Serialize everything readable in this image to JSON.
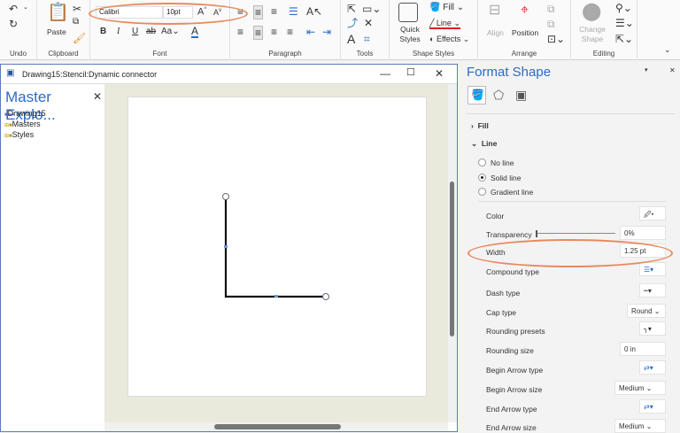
{
  "ribbon": {
    "groups": {
      "undo": "Undo",
      "clipboard": "Clipboard",
      "font": "Font",
      "paragraph": "Paragraph",
      "tools": "Tools",
      "shape_styles": "Shape Styles",
      "arrange": "Arrange",
      "editing": "Editing"
    },
    "paste_label": "Paste",
    "font_name": "Calibri",
    "font_size": "10pt",
    "quick_styles_label": "Quick Styles",
    "fill_label": "Fill",
    "line_label": "Line",
    "effects_label": "Effects",
    "align_label": "Align",
    "position_label": "Position",
    "change_shape_label": "Change Shape"
  },
  "drawing_window": {
    "title": "Drawing15:Stencil:Dynamic connector",
    "explorer_title": "Master Explo...",
    "tree": [
      "Drawing15",
      "Masters",
      "Styles"
    ]
  },
  "format_shape": {
    "title": "Format Shape",
    "fill_label": "Fill",
    "line_label": "Line",
    "line_options": [
      "No line",
      "Solid line",
      "Gradient line"
    ],
    "selected_line_option": "Solid line",
    "color_label": "Color",
    "transparency_label": "Transparency",
    "transparency_value": "0%",
    "width_label": "Width",
    "width_value": "1.25 pt",
    "compound_label": "Compound type",
    "dash_label": "Dash type",
    "cap_label": "Cap type",
    "cap_value": "Round",
    "rounding_presets_label": "Rounding presets",
    "rounding_size_label": "Rounding size",
    "rounding_size_value": "0 in",
    "begin_arrow_type_label": "Begin Arrow type",
    "begin_arrow_size_label": "Begin Arrow size",
    "begin_arrow_size_value": "Medium",
    "end_arrow_type_label": "End Arrow type",
    "end_arrow_size_label": "End Arrow size",
    "end_arrow_size_value": "Medium"
  },
  "colors": {
    "accent": "#2b6cc4",
    "highlight": "#e88a5e",
    "font_color": "#1f6fd1",
    "line_red": "#e02020"
  }
}
